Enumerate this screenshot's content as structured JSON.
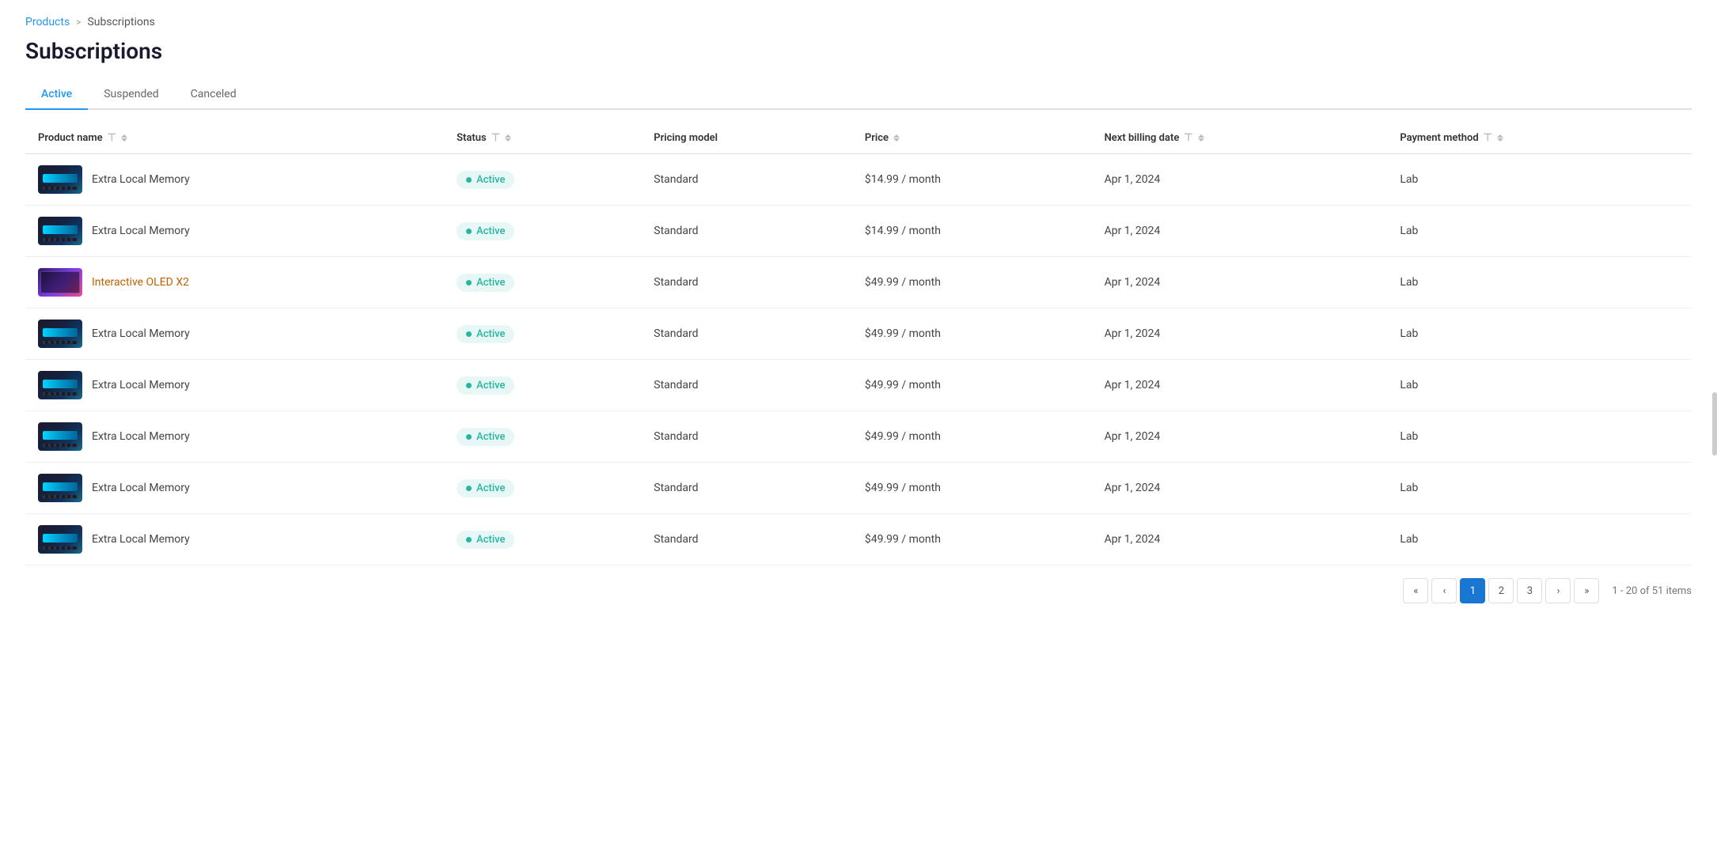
{
  "breadcrumb": {
    "parent": "Products",
    "separator": ">",
    "current": "Subscriptions"
  },
  "page": {
    "title": "Subscriptions"
  },
  "tabs": [
    {
      "id": "active",
      "label": "Active",
      "active": true
    },
    {
      "id": "suspended",
      "label": "Suspended",
      "active": false
    },
    {
      "id": "canceled",
      "label": "Canceled",
      "active": false
    }
  ],
  "table": {
    "columns": [
      {
        "id": "product_name",
        "label": "Product name",
        "filterable": true,
        "sortable": true
      },
      {
        "id": "status",
        "label": "Status",
        "filterable": true,
        "sortable": true
      },
      {
        "id": "pricing_model",
        "label": "Pricing model",
        "filterable": false,
        "sortable": false
      },
      {
        "id": "price",
        "label": "Price",
        "filterable": false,
        "sortable": true
      },
      {
        "id": "next_billing_date",
        "label": "Next billing date",
        "filterable": true,
        "sortable": true
      },
      {
        "id": "payment_method",
        "label": "Payment method",
        "filterable": true,
        "sortable": true
      }
    ],
    "rows": [
      {
        "id": 1,
        "product_name": "Extra Local Memory",
        "product_type": "ram",
        "status": "Active",
        "pricing_model": "Standard",
        "price": "$14.99 / month",
        "next_billing_date": "Apr 1, 2024",
        "payment_method": "Lab"
      },
      {
        "id": 2,
        "product_name": "Extra Local Memory",
        "product_type": "ram",
        "status": "Active",
        "pricing_model": "Standard",
        "price": "$14.99 / month",
        "next_billing_date": "Apr 1, 2024",
        "payment_method": "Lab"
      },
      {
        "id": 3,
        "product_name": "Interactive OLED X2",
        "product_type": "oled",
        "status": "Active",
        "pricing_model": "Standard",
        "price": "$49.99 / month",
        "next_billing_date": "Apr 1, 2024",
        "payment_method": "Lab"
      },
      {
        "id": 4,
        "product_name": "Extra Local Memory",
        "product_type": "ram",
        "status": "Active",
        "pricing_model": "Standard",
        "price": "$49.99 / month",
        "next_billing_date": "Apr 1, 2024",
        "payment_method": "Lab"
      },
      {
        "id": 5,
        "product_name": "Extra Local Memory",
        "product_type": "ram",
        "status": "Active",
        "pricing_model": "Standard",
        "price": "$49.99 / month",
        "next_billing_date": "Apr 1, 2024",
        "payment_method": "Lab"
      },
      {
        "id": 6,
        "product_name": "Extra Local Memory",
        "product_type": "ram",
        "status": "Active",
        "pricing_model": "Standard",
        "price": "$49.99 / month",
        "next_billing_date": "Apr 1, 2024",
        "payment_method": "Lab"
      },
      {
        "id": 7,
        "product_name": "Extra Local Memory",
        "product_type": "ram",
        "status": "Active",
        "pricing_model": "Standard",
        "price": "$49.99 / month",
        "next_billing_date": "Apr 1, 2024",
        "payment_method": "Lab"
      },
      {
        "id": 8,
        "product_name": "Extra Local Memory",
        "product_type": "ram",
        "status": "Active",
        "pricing_model": "Standard",
        "price": "$49.99 / month",
        "next_billing_date": "Apr 1, 2024",
        "payment_method": "Lab"
      }
    ]
  },
  "pagination": {
    "current_page": 1,
    "total_pages": 3,
    "pages": [
      1,
      2,
      3
    ],
    "total_items": 51,
    "items_per_page": 20,
    "range_text": "1 - 20 of 51 items",
    "first_label": "«",
    "prev_label": "‹",
    "next_label": "›",
    "last_label": "»"
  }
}
